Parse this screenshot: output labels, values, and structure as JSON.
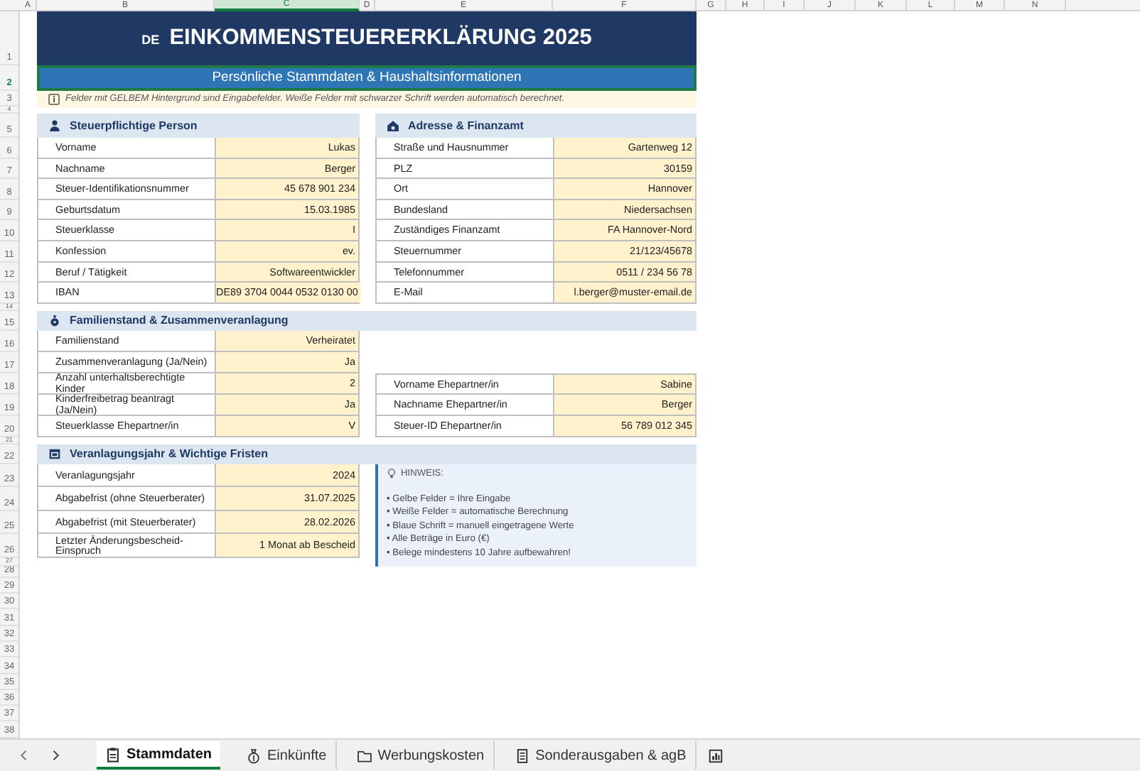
{
  "column_headers": [
    {
      "label": "A",
      "selected": false
    },
    {
      "label": "B",
      "selected": false
    },
    {
      "label": "C",
      "selected": true
    },
    {
      "label": "D",
      "selected": false
    },
    {
      "label": "E",
      "selected": false
    },
    {
      "label": "F",
      "selected": false
    },
    {
      "label": "G",
      "selected": false
    },
    {
      "label": "H",
      "selected": false
    },
    {
      "label": "I",
      "selected": false
    },
    {
      "label": "J",
      "selected": false
    },
    {
      "label": "K",
      "selected": false
    },
    {
      "label": "L",
      "selected": false
    },
    {
      "label": "M",
      "selected": false
    },
    {
      "label": "N",
      "selected": false
    }
  ],
  "row_headers": [
    {
      "label": "1",
      "selected": false
    },
    {
      "label": "2",
      "selected": true
    },
    {
      "label": "3",
      "selected": false
    },
    {
      "label": "4",
      "selected": false
    },
    {
      "label": "5",
      "selected": false
    },
    {
      "label": "6",
      "selected": false
    },
    {
      "label": "7",
      "selected": false
    },
    {
      "label": "8",
      "selected": false
    },
    {
      "label": "9",
      "selected": false
    },
    {
      "label": "10",
      "selected": false
    },
    {
      "label": "11",
      "selected": false
    },
    {
      "label": "12",
      "selected": false
    },
    {
      "label": "13",
      "selected": false
    },
    {
      "label": "14",
      "selected": false
    },
    {
      "label": "15",
      "selected": false
    },
    {
      "label": "16",
      "selected": false
    },
    {
      "label": "17",
      "selected": false
    },
    {
      "label": "18",
      "selected": false
    },
    {
      "label": "19",
      "selected": false
    },
    {
      "label": "20",
      "selected": false
    },
    {
      "label": "21",
      "selected": false
    },
    {
      "label": "22",
      "selected": false
    },
    {
      "label": "23",
      "selected": false
    },
    {
      "label": "24",
      "selected": false
    },
    {
      "label": "25",
      "selected": false
    },
    {
      "label": "26",
      "selected": false
    },
    {
      "label": "27",
      "selected": false
    },
    {
      "label": "28",
      "selected": false
    },
    {
      "label": "29",
      "selected": false
    },
    {
      "label": "30",
      "selected": false
    },
    {
      "label": "31",
      "selected": false
    },
    {
      "label": "32",
      "selected": false
    },
    {
      "label": "33",
      "selected": false
    },
    {
      "label": "34",
      "selected": false
    },
    {
      "label": "35",
      "selected": false
    },
    {
      "label": "36",
      "selected": false
    },
    {
      "label": "37",
      "selected": false
    },
    {
      "label": "38",
      "selected": false
    }
  ],
  "title": {
    "flag": "DE",
    "text": "EINKOMMENSTEUERERKLÄRUNG 2025"
  },
  "subtitle": {
    "text": "Persönliche Stammdaten & Haushaltsinformationen",
    "selected": true
  },
  "note": "Felder mit GELBEM Hintergrund sind Eingabefelder. Weiße Felder mit schwarzer Schrift werden automatisch berechnet.",
  "taxpayer": {
    "heading": "Steuerpflichtige Person",
    "rows": [
      {
        "label": "Vorname",
        "value": "Lukas"
      },
      {
        "label": "Nachname",
        "value": "Berger"
      },
      {
        "label": "Steuer-Identifikationsnummer",
        "value": "45 678 901 234"
      },
      {
        "label": "Geburtsdatum",
        "value": "15.03.1985"
      },
      {
        "label": "Steuerklasse",
        "value": "I"
      },
      {
        "label": "Konfession",
        "value": "ev."
      },
      {
        "label": "Beruf / Tätigkeit",
        "value": "Softwareentwickler"
      },
      {
        "label": "IBAN",
        "value": "DE89 3704 0044 0532 0130 00"
      }
    ]
  },
  "address": {
    "heading": "Adresse & Finanzamt",
    "rows": [
      {
        "label": "Straße und Hausnummer",
        "value": "Gartenweg 12"
      },
      {
        "label": "PLZ",
        "value": "30159"
      },
      {
        "label": "Ort",
        "value": "Hannover"
      },
      {
        "label": "Bundesland",
        "value": "Niedersachsen"
      },
      {
        "label": "Zuständiges Finanzamt",
        "value": "FA Hannover-Nord"
      },
      {
        "label": "Steuernummer",
        "value": "21/123/45678"
      },
      {
        "label": "Telefonnummer",
        "value": "0511 / 234 56 78"
      },
      {
        "label": "E-Mail",
        "value": "l.berger@muster-email.de"
      }
    ]
  },
  "family": {
    "heading": "Familienstand & Zusammenveranlagung",
    "rows": [
      {
        "label": "Familienstand",
        "value": "Verheiratet"
      },
      {
        "label": "Zusammenveranlagung (Ja/Nein)",
        "value": "Ja"
      },
      {
        "label": "Anzahl unterhaltsberechtigte Kinder",
        "value": "2"
      },
      {
        "label": "Kinderfreibetrag beantragt (Ja/Nein)",
        "value": "Ja"
      },
      {
        "label": "Steuerklasse Ehepartner/in",
        "value": "V"
      }
    ],
    "spouse_rows": [
      {
        "label": "Vorname Ehepartner/in",
        "value": "Sabine"
      },
      {
        "label": "Nachname Ehepartner/in",
        "value": "Berger"
      },
      {
        "label": "Steuer-ID Ehepartner/in",
        "value": "56 789 012 345"
      }
    ]
  },
  "deadlines": {
    "heading": "Veranlagungsjahr & Wichtige Fristen",
    "rows": [
      {
        "label": "Veranlagungsjahr",
        "value": "2024"
      },
      {
        "label": "Abgabefrist (ohne Steuerberater)",
        "value": "31.07.2025"
      },
      {
        "label": "Abgabefrist (mit Steuerberater)",
        "value": "28.02.2026"
      },
      {
        "label": "Letzter Änderungsbescheid-Einspruch",
        "value": "1 Monat ab Bescheid"
      }
    ]
  },
  "hint": {
    "heading": "HINWEIS:",
    "lines": [
      "• Gelbe Felder = Ihre Eingabe",
      "• Weiße Felder = automatische Berechnung",
      "• Blaue Schrift = manuell eingetragene Werte",
      "• Alle Beträge in Euro (€)",
      "• Belege mindestens 10 Jahre aufbewahren!"
    ]
  },
  "sheet_tabs": [
    {
      "label": "Stammdaten",
      "selected": true,
      "kind": "clipboard"
    },
    {
      "label": "Einkünfte",
      "selected": false,
      "kind": "moneybag"
    },
    {
      "label": "Werbungskosten",
      "selected": false,
      "kind": "folder"
    },
    {
      "label": "Sonderausgaben & agB",
      "selected": false,
      "kind": "document"
    }
  ]
}
